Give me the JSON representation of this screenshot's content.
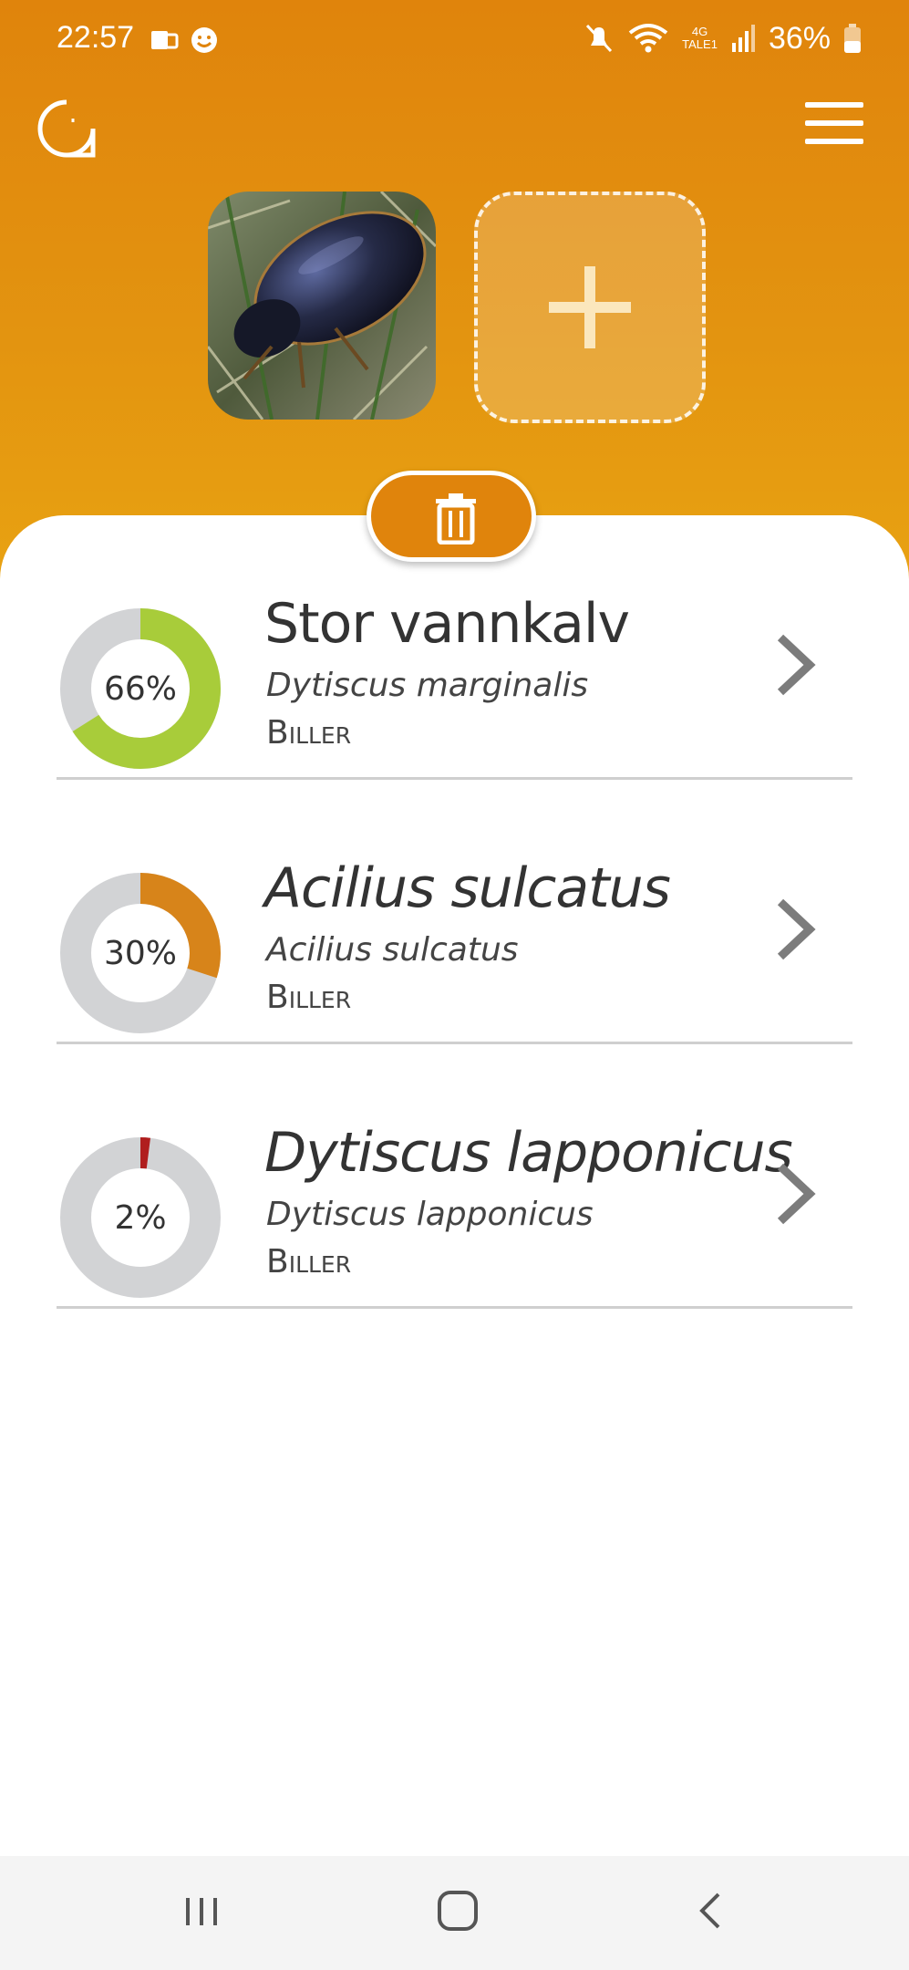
{
  "status_bar": {
    "time": "22:57",
    "battery_percent": "36%",
    "network_label": "4G",
    "network_sublabel": "TALE1",
    "icons": [
      "notification-app-icon",
      "smiley-icon",
      "mute-icon",
      "wifi-icon",
      "signal-icon",
      "battery-icon"
    ]
  },
  "header": {
    "logo_icon": "search-lens-logo-icon",
    "menu_icon": "hamburger-menu-icon",
    "add_icon": "plus-icon",
    "delete_icon": "trash-icon"
  },
  "results": [
    {
      "percent_label": "66%",
      "percent": 66,
      "color": "#a8cc3a",
      "name": "Stor vannkalv",
      "name_italic": false,
      "scientific": "Dytiscus marginalis",
      "group": "Biller"
    },
    {
      "percent_label": "30%",
      "percent": 30,
      "color": "#d7841a",
      "name": "Acilius sulcatus",
      "name_italic": true,
      "scientific": "Acilius sulcatus",
      "group": "Biller"
    },
    {
      "percent_label": "2%",
      "percent": 2,
      "color": "#b01e1e",
      "name": "Dytiscus lapponicus",
      "name_italic": true,
      "scientific": "Dytiscus lapponicus",
      "group": "Biller"
    }
  ],
  "colors": {
    "header_top": "#e0840c",
    "header_bottom": "#e9a412",
    "donut_track": "#d2d3d5"
  },
  "nav_bar": {
    "icons": [
      "recent-apps-icon",
      "home-icon",
      "back-icon"
    ]
  }
}
